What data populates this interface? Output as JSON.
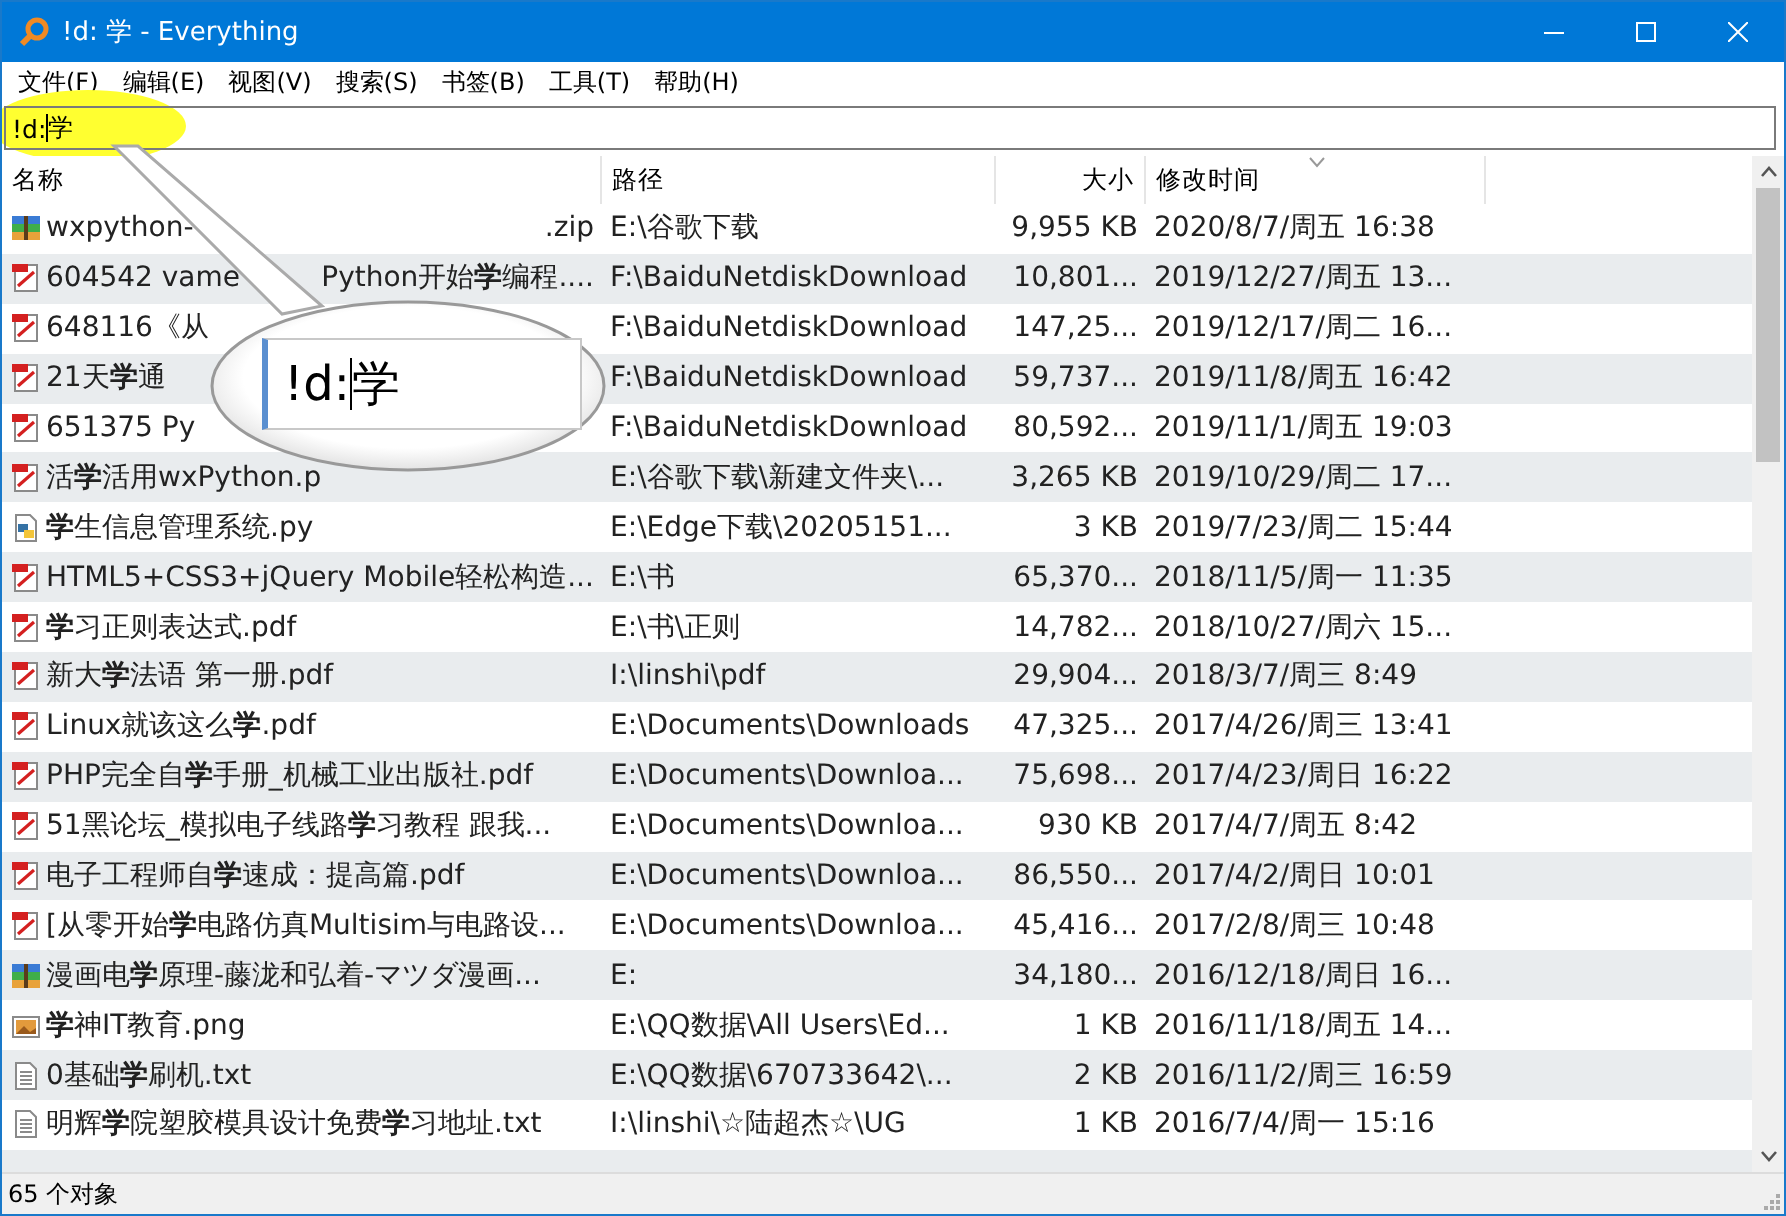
{
  "window": {
    "title": "!d: 学 - Everything"
  },
  "menu": [
    "文件(F)",
    "编辑(E)",
    "视图(V)",
    "搜索(S)",
    "书签(B)",
    "工具(T)",
    "帮助(H)"
  ],
  "search": {
    "value": "!d:学",
    "highlighted": true
  },
  "callout": {
    "value": "!d:学"
  },
  "table": {
    "columns": [
      {
        "label": "名称",
        "sorted": false
      },
      {
        "label": "路径",
        "sorted": false
      },
      {
        "label": "大小",
        "sorted": false
      },
      {
        "label": "修改时间",
        "sorted": true
      }
    ],
    "rows": [
      {
        "kind": "zip",
        "name": "wxpython-",
        "name_tail": ".zip",
        "path": "E:\\谷歌下载",
        "size": "9,955 KB",
        "modified": "2020/8/7/周五 16:38"
      },
      {
        "kind": "pdf",
        "name": "604542 vame",
        "name_tail": "Python开始**学**编程....",
        "path": "F:\\BaiduNetdiskDownload",
        "size": "10,801...",
        "modified": "2019/12/27/周五 13..."
      },
      {
        "kind": "pdf",
        "name": "648116《从",
        "path": "F:\\BaiduNetdiskDownload",
        "size": "147,25...",
        "modified": "2019/12/17/周二 16..."
      },
      {
        "kind": "pdf",
        "name": "21天**学**通",
        "path": "F:\\BaiduNetdiskDownload",
        "size": "59,737...",
        "modified": "2019/11/8/周五 16:42"
      },
      {
        "kind": "pdf",
        "name": "651375 Py",
        "path": "F:\\BaiduNetdiskDownload",
        "size": "80,592...",
        "modified": "2019/11/1/周五 19:03"
      },
      {
        "kind": "pdf",
        "name": "活**学**活用wxPython.p",
        "path": "E:\\谷歌下载\\新建文件夹\\...",
        "size": "3,265 KB",
        "modified": "2019/10/29/周二 17..."
      },
      {
        "kind": "py",
        "name": "**学**生信息管理系统.py",
        "path": "E:\\Edge下载\\20205151...",
        "size": "3 KB",
        "modified": "2019/7/23/周二 15:44"
      },
      {
        "kind": "pdf",
        "name": "HTML5+CSS3+jQuery Mobile轻松构造...",
        "path": "E:\\书",
        "size": "65,370...",
        "modified": "2018/11/5/周一 11:35"
      },
      {
        "kind": "pdf",
        "name": "**学**习正则表达式.pdf",
        "path": "E:\\书\\正则",
        "size": "14,782...",
        "modified": "2018/10/27/周六 15..."
      },
      {
        "kind": "pdf",
        "name": "新大**学**法语 第一册.pdf",
        "path": "I:\\linshi\\pdf",
        "size": "29,904...",
        "modified": "2018/3/7/周三 8:49"
      },
      {
        "kind": "pdf",
        "name": "Linux就该这么**学**.pdf",
        "path": "E:\\Documents\\Downloads",
        "size": "47,325...",
        "modified": "2017/4/26/周三 13:41"
      },
      {
        "kind": "pdf",
        "name": "PHP完全自**学**手册_机械工业出版社.pdf",
        "path": "E:\\Documents\\Downloa...",
        "size": "75,698...",
        "modified": "2017/4/23/周日 16:22"
      },
      {
        "kind": "pdf",
        "name": "51黑论坛_模拟电子线路**学**习教程 跟我...",
        "path": "E:\\Documents\\Downloa...",
        "size": "930 KB",
        "modified": "2017/4/7/周五 8:42"
      },
      {
        "kind": "pdf",
        "name": "电子工程师自**学**速成：提高篇.pdf",
        "path": "E:\\Documents\\Downloa...",
        "size": "86,550...",
        "modified": "2017/4/2/周日 10:01"
      },
      {
        "kind": "pdf",
        "name": "[从零开始**学**电路仿真Multisim与电路设...",
        "path": "E:\\Documents\\Downloa...",
        "size": "45,416...",
        "modified": "2017/2/8/周三 10:48"
      },
      {
        "kind": "zip",
        "name": "漫画电**学**原理-藤泷和弘着-マツダ漫画...",
        "path": "E:",
        "size": "34,180...",
        "modified": "2016/12/18/周日 16..."
      },
      {
        "kind": "png",
        "name": "**学**神IT教育.png",
        "path": "E:\\QQ数据\\All Users\\Ed...",
        "size": "1 KB",
        "modified": "2016/11/18/周五 14..."
      },
      {
        "kind": "txt",
        "name": "0基础**学**刷机.txt",
        "path": "E:\\QQ数据\\670733642\\...",
        "size": "2 KB",
        "modified": "2016/11/2/周三 16:59"
      },
      {
        "kind": "txt",
        "name": "明辉**学**院塑胶模具设计免费**学**习地址.txt",
        "path": "I:\\linshi\\☆陆超杰☆\\UG",
        "size": "1 KB",
        "modified": "2016/7/4/周一 15:16"
      }
    ]
  },
  "status_bar": "65 个对象"
}
